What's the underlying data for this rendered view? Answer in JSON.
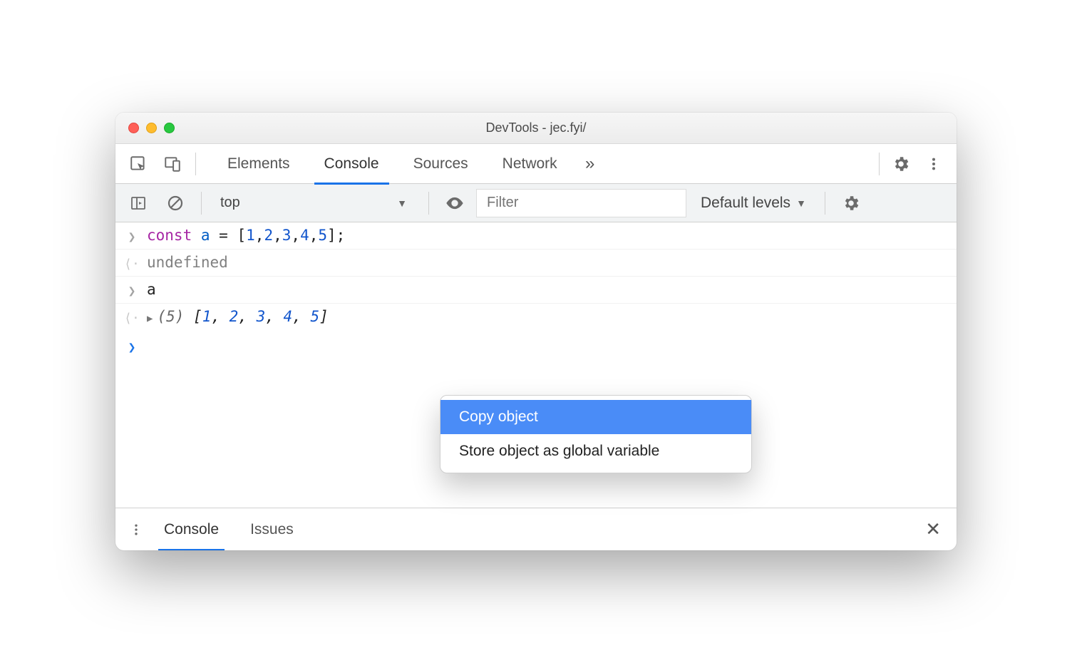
{
  "window": {
    "title": "DevTools - jec.fyi/"
  },
  "tabs": {
    "items": [
      "Elements",
      "Console",
      "Sources",
      "Network"
    ],
    "active_index": 1
  },
  "console_toolbar": {
    "context": "top",
    "filter_placeholder": "Filter",
    "levels_label": "Default levels"
  },
  "console": {
    "lines": [
      {
        "kind": "input",
        "code": {
          "kw": "const",
          "ident": "a",
          "eq": " = ",
          "nums": [
            "1",
            "2",
            "3",
            "4",
            "5"
          ]
        }
      },
      {
        "kind": "return",
        "text": "undefined"
      },
      {
        "kind": "input",
        "text": "a"
      },
      {
        "kind": "result",
        "count": "(5)",
        "values": [
          "1",
          "2",
          "3",
          "4",
          "5"
        ]
      }
    ]
  },
  "context_menu": {
    "items": [
      "Copy object",
      "Store object as global variable"
    ],
    "highlight_index": 0
  },
  "drawer": {
    "tabs": [
      "Console",
      "Issues"
    ],
    "active_index": 0
  }
}
